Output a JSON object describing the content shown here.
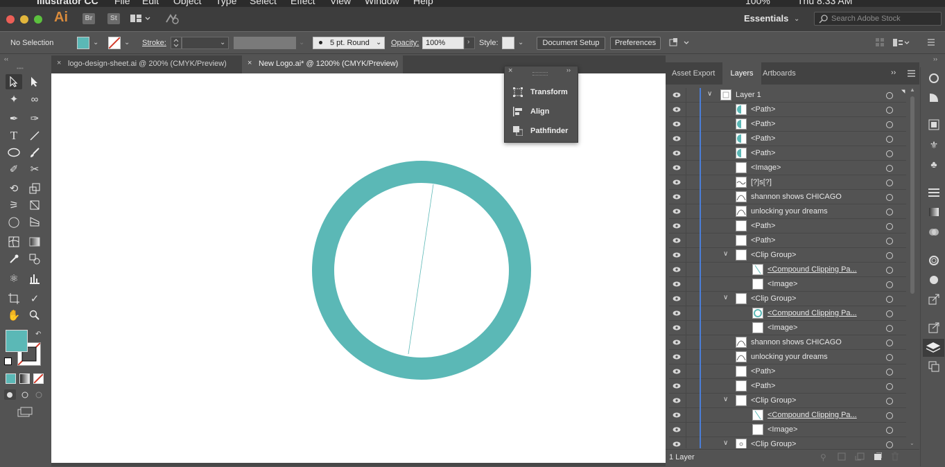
{
  "menubar": {
    "app_name": "Illustrator CC",
    "menus": [
      "File",
      "Edit",
      "Object",
      "Type",
      "Select",
      "Effect",
      "View",
      "Window",
      "Help"
    ],
    "battery": "100%",
    "clock": "Thu 8:33 AM"
  },
  "appbar": {
    "logo": "Ai",
    "bridge": "Br",
    "stock": "St",
    "workspace": "Essentials",
    "search_placeholder": "Search Adobe Stock"
  },
  "control_bar": {
    "selection_status": "No Selection",
    "fill_color": "#5bb8b6",
    "stroke_label": "Stroke:",
    "brush_label": "5 pt. Round",
    "opacity_label": "Opacity:",
    "opacity_value": "100%",
    "style_label": "Style:",
    "document_setup": "Document Setup",
    "preferences": "Preferences"
  },
  "tabs": [
    {
      "label": "logo-design-sheet.ai @ 200% (CMYK/Preview)",
      "active": false
    },
    {
      "label": "New Logo.ai* @ 1200% (CMYK/Preview)",
      "active": true
    }
  ],
  "float_panel": {
    "items": [
      {
        "label": "Transform",
        "icon": "transform-icon"
      },
      {
        "label": "Align",
        "icon": "align-icon"
      },
      {
        "label": "Pathfinder",
        "icon": "pathfinder-icon"
      }
    ]
  },
  "layers_panel": {
    "tabs": [
      "Asset Export",
      "Layers",
      "Artboards"
    ],
    "active_tab": "Layers",
    "footer": "1 Layer",
    "rows": [
      {
        "name": "Layer 1",
        "indent": 0,
        "arrow": "v",
        "thumb": "layer"
      },
      {
        "name": "<Path>",
        "indent": 1,
        "arrow": "",
        "thumb": "half"
      },
      {
        "name": "<Path>",
        "indent": 1,
        "arrow": "",
        "thumb": "half"
      },
      {
        "name": "<Path>",
        "indent": 1,
        "arrow": "",
        "thumb": "half"
      },
      {
        "name": "<Path>",
        "indent": 1,
        "arrow": "",
        "thumb": "half"
      },
      {
        "name": "<Image>",
        "indent": 1,
        "arrow": "",
        "thumb": "plain"
      },
      {
        "name": "[?]s[?]",
        "indent": 1,
        "arrow": "",
        "thumb": "scribble"
      },
      {
        "name": "shannon shows CHICAGO",
        "indent": 1,
        "arrow": "",
        "thumb": "arc"
      },
      {
        "name": "unlocking your dreams",
        "indent": 1,
        "arrow": "",
        "thumb": "arc"
      },
      {
        "name": "<Path>",
        "indent": 1,
        "arrow": "",
        "thumb": "plain"
      },
      {
        "name": "<Path>",
        "indent": 1,
        "arrow": "",
        "thumb": "plain"
      },
      {
        "name": "<Clip Group>",
        "indent": 1,
        "arrow": "v",
        "thumb": "plain"
      },
      {
        "name": "<Compound Clipping Pa...",
        "indent": 2,
        "arrow": "",
        "thumb": "line",
        "underline": true
      },
      {
        "name": "<Image>",
        "indent": 2,
        "arrow": "",
        "thumb": "plain"
      },
      {
        "name": "<Clip Group>",
        "indent": 1,
        "arrow": "v",
        "thumb": "plain"
      },
      {
        "name": "<Compound Clipping Pa...",
        "indent": 2,
        "arrow": "",
        "thumb": "ring",
        "underline": true
      },
      {
        "name": "<Image>",
        "indent": 2,
        "arrow": "",
        "thumb": "plain"
      },
      {
        "name": "shannon shows CHICAGO",
        "indent": 1,
        "arrow": "",
        "thumb": "arc"
      },
      {
        "name": "unlocking your dreams",
        "indent": 1,
        "arrow": "",
        "thumb": "arc"
      },
      {
        "name": "<Path>",
        "indent": 1,
        "arrow": "",
        "thumb": "plain"
      },
      {
        "name": "<Path>",
        "indent": 1,
        "arrow": "",
        "thumb": "plain"
      },
      {
        "name": "<Clip Group>",
        "indent": 1,
        "arrow": "v",
        "thumb": "plain"
      },
      {
        "name": "<Compound Clipping Pa...",
        "indent": 2,
        "arrow": "",
        "thumb": "line",
        "underline": true
      },
      {
        "name": "<Image>",
        "indent": 2,
        "arrow": "",
        "thumb": "plain"
      },
      {
        "name": "<Clip Group>",
        "indent": 1,
        "arrow": "v",
        "thumb": "dot"
      }
    ]
  },
  "colors": {
    "teal": "#5bb8b6",
    "layer_bar": "#4b7ed8"
  }
}
